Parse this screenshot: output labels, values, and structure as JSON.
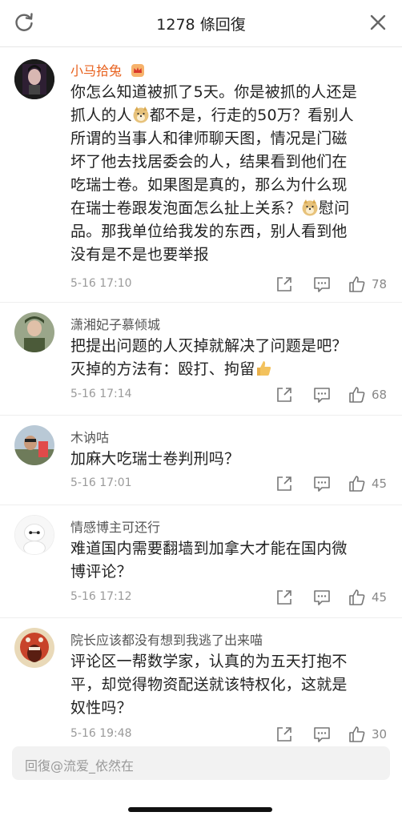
{
  "header": {
    "title": "1278 條回復",
    "refresh_icon": "refresh-icon",
    "close_icon": "close-icon"
  },
  "comments": [
    {
      "user": "小马拾兔",
      "vip": true,
      "avatar_color": "#1d1d1d",
      "lines": [
        "你怎么知道被抓了5天。你是被抓的人还是",
        "抓人的人",
        "都不是，行走的50万？看别人",
        "所谓的当事人和律师聊天图，情况是门磁",
        "坏了他去找居委会的人，结果看到他们在",
        "吃瑞士卷。如果图是真的，那么为什么现",
        "在瑞士卷跟发泡面怎么扯上关系？",
        "慰问",
        "品。那我单位给我发的东西，别人看到他",
        "没有是不是也要举报"
      ],
      "time": "5-16 17:10",
      "likes": "78"
    },
    {
      "user": "潇湘妃子慕倾城",
      "vip": false,
      "avatar_color": "#4a5a3a",
      "lines": [
        "把提出问题的人灭掉就解决了问题是吧？",
        "灭掉的方法有：殴打、拘留"
      ],
      "time": "5-16 17:14",
      "likes": "68"
    },
    {
      "user": "木讷咕",
      "vip": false,
      "avatar_color": "#8aa2b8",
      "lines": [
        "加麻大吃瑞士卷判刑吗？"
      ],
      "time": "5-16 17:01",
      "likes": "45"
    },
    {
      "user": "情感博主可还行",
      "vip": false,
      "avatar_color": "#f4f4f4",
      "lines": [
        "难道国内需要翻墙到加拿大才能在国内微",
        "博评论？"
      ],
      "time": "5-16 17:12",
      "likes": "45"
    },
    {
      "user": "院长应该都没有想到我逃了出来喵",
      "vip": false,
      "avatar_color": "#c84a2a",
      "lines": [
        "评论区一帮数学家，认真的为五天打抱不",
        "平，却觉得物资配送就该特权化，这就是",
        "奴性吗？"
      ],
      "time": "5-16 19:48",
      "likes": "30"
    }
  ],
  "reply_bar": {
    "placeholder": "回復@流爱_依然在"
  },
  "icons": {
    "share": "share-icon",
    "reply": "comment-icon",
    "like": "thumbs-up-icon",
    "crown": "crown-badge-icon",
    "doge": "doge-emoji-icon",
    "thumb_emoji": "thumbs-up-emoji-icon"
  }
}
